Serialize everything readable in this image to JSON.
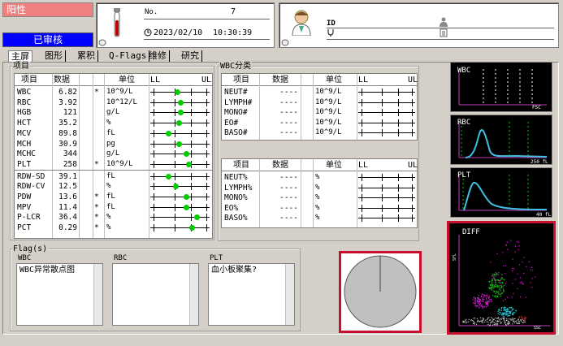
{
  "header": {
    "status_positive": "阳性",
    "status_reviewed": "已审核",
    "no_label": "No.",
    "sample_no": "7",
    "date": "2023/02/10",
    "time": "10:30:39",
    "id_label": "ID"
  },
  "tabs": [
    "主屏",
    "图形",
    "累积",
    "Q-Flags",
    "维修",
    "研究"
  ],
  "params": {
    "group_title": "项目",
    "headers": {
      "item": "项目",
      "data": "数据",
      "unit": "单位",
      "ll": "LL",
      "ul": "UL"
    },
    "rows": [
      {
        "name": "WBC",
        "value": "6.82",
        "flag": "*",
        "unit": "10^9/L",
        "pos": 0.45
      },
      {
        "name": "RBC",
        "value": "3.92",
        "flag": "",
        "unit": "10^12/L",
        "pos": 0.5
      },
      {
        "name": "HGB",
        "value": "121",
        "flag": "",
        "unit": "g/L",
        "pos": 0.5
      },
      {
        "name": "HCT",
        "value": "35.2",
        "flag": "",
        "unit": "%",
        "pos": 0.48
      },
      {
        "name": "MCV",
        "value": "89.8",
        "flag": "",
        "unit": "fL",
        "pos": 0.3
      },
      {
        "name": "MCH",
        "value": "30.9",
        "flag": "",
        "unit": "pg",
        "pos": 0.48
      },
      {
        "name": "MCHC",
        "value": "344",
        "flag": "",
        "unit": "g/L",
        "pos": 0.6
      },
      {
        "name": "PLT",
        "value": "258",
        "flag": "*",
        "unit": "10^9/L",
        "pos": 0.65
      },
      {
        "name": "RDW-SD",
        "value": "39.1",
        "flag": "",
        "unit": "fL",
        "pos": 0.3
      },
      {
        "name": "RDW-CV",
        "value": "12.5",
        "flag": "",
        "unit": "%",
        "pos": 0.42
      },
      {
        "name": "PDW",
        "value": "13.6",
        "flag": "*",
        "unit": "fL",
        "pos": 0.6
      },
      {
        "name": "MPV",
        "value": "11.4",
        "flag": "*",
        "unit": "fL",
        "pos": 0.6
      },
      {
        "name": "P-LCR",
        "value": "36.4",
        "flag": "*",
        "unit": "%",
        "pos": 0.78
      },
      {
        "name": "PCT",
        "value": "0.29",
        "flag": "*",
        "unit": "%",
        "pos": 0.7
      }
    ]
  },
  "wbc_diff": {
    "group_title": "WBC分类",
    "headers": {
      "item": "项目",
      "data": "数据",
      "unit": "单位",
      "ll": "LL",
      "ul": "UL"
    },
    "abs_rows": [
      {
        "name": "NEUT#",
        "value": "----",
        "unit": "10^9/L"
      },
      {
        "name": "LYMPH#",
        "value": "----",
        "unit": "10^9/L"
      },
      {
        "name": "MONO#",
        "value": "----",
        "unit": "10^9/L"
      },
      {
        "name": "EO#",
        "value": "----",
        "unit": "10^9/L"
      },
      {
        "name": "BASO#",
        "value": "----",
        "unit": "10^9/L"
      }
    ],
    "pct_rows": [
      {
        "name": "NEUT%",
        "value": "----",
        "unit": "%"
      },
      {
        "name": "LYMPH%",
        "value": "----",
        "unit": "%"
      },
      {
        "name": "MONO%",
        "value": "----",
        "unit": "%"
      },
      {
        "name": "EO%",
        "value": "----",
        "unit": "%"
      },
      {
        "name": "BASO%",
        "value": "----",
        "unit": "%"
      }
    ]
  },
  "flags": {
    "title": "Flag(s)",
    "wbc_label": "WBC",
    "rbc_label": "RBC",
    "plt_label": "PLT",
    "wbc_items": [
      "WBC异常散点图"
    ],
    "rbc_items": [],
    "plt_items": [
      "血小板聚集?"
    ]
  },
  "scopes": {
    "wbc": {
      "title": "WBC",
      "axis": "FSC"
    },
    "rbc": {
      "title": "RBC",
      "axis": "250 fL"
    },
    "plt": {
      "title": "PLT",
      "axis": "40 fL"
    },
    "diff": {
      "title": "DIFF",
      "axis_x": "SSC",
      "axis_y": "SFL"
    }
  },
  "colors": {
    "positive": "#f08080",
    "reviewed": "#0000ff",
    "highlight": "#c8102e",
    "curve": "#40c0e0",
    "marker": "#00cc00"
  }
}
